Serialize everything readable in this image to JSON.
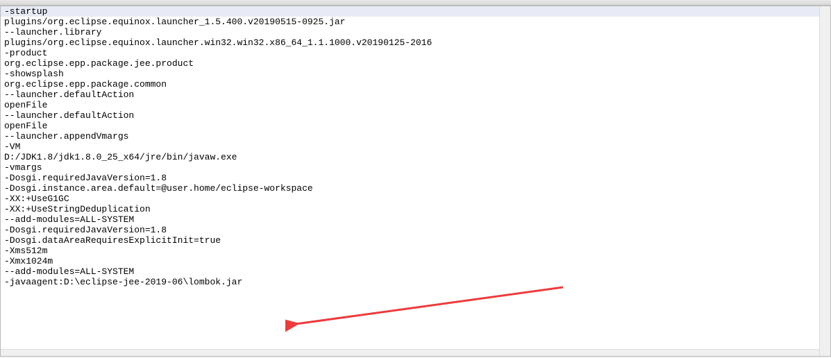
{
  "editor": {
    "lines": [
      "-startup",
      "plugins/org.eclipse.equinox.launcher_1.5.400.v20190515-0925.jar",
      "--launcher.library",
      "plugins/org.eclipse.equinox.launcher.win32.win32.x86_64_1.1.1000.v20190125-2016",
      "-product",
      "org.eclipse.epp.package.jee.product",
      "-showsplash",
      "org.eclipse.epp.package.common",
      "--launcher.defaultAction",
      "openFile",
      "--launcher.defaultAction",
      "openFile",
      "--launcher.appendVmargs",
      "-VM",
      "D:/JDK1.8/jdk1.8.0_25_x64/jre/bin/javaw.exe",
      "-vmargs",
      "-Dosgi.requiredJavaVersion=1.8",
      "-Dosgi.instance.area.default=@user.home/eclipse-workspace",
      "-XX:+UseG1GC",
      "-XX:+UseStringDeduplication",
      "--add-modules=ALL-SYSTEM",
      "-Dosgi.requiredJavaVersion=1.8",
      "-Dosgi.dataAreaRequiresExplicitInit=true",
      "-Xms512m",
      "-Xmx1024m",
      "--add-modules=ALL-SYSTEM",
      "-javaagent:D:\\eclipse-jee-2019-06\\lombok.jar"
    ],
    "highlighted_line_index": 0
  },
  "annotation": {
    "arrow_color": "#ed3b3b"
  }
}
